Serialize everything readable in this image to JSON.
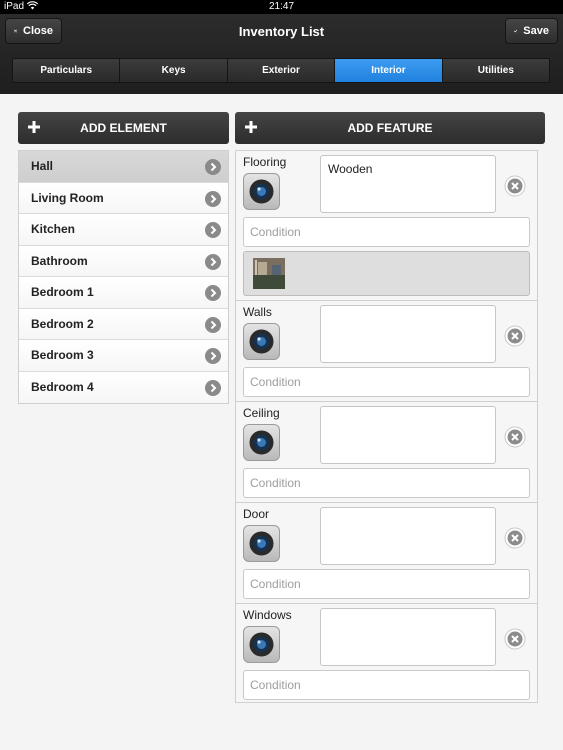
{
  "status": {
    "carrier": "iPad",
    "time": "21:47"
  },
  "header": {
    "title": "Inventory List",
    "close_label": "Close",
    "save_label": "Save"
  },
  "tabs": [
    {
      "label": "Particulars",
      "active": false
    },
    {
      "label": "Keys",
      "active": false
    },
    {
      "label": "Exterior",
      "active": false
    },
    {
      "label": "Interior",
      "active": true
    },
    {
      "label": "Utilities",
      "active": false
    }
  ],
  "add_element_label": "ADD ELEMENT",
  "add_feature_label": "ADD FEATURE",
  "rooms": [
    {
      "label": "Hall",
      "selected": true
    },
    {
      "label": "Living Room",
      "selected": false
    },
    {
      "label": "Kitchen",
      "selected": false
    },
    {
      "label": "Bathroom",
      "selected": false
    },
    {
      "label": "Bedroom 1",
      "selected": false
    },
    {
      "label": "Bedroom 2",
      "selected": false
    },
    {
      "label": "Bedroom 3",
      "selected": false
    },
    {
      "label": "Bedroom 4",
      "selected": false
    }
  ],
  "features": [
    {
      "name": "Flooring",
      "note": "Wooden",
      "condition_placeholder": "Condition",
      "condition_value": "",
      "has_photo": true
    },
    {
      "name": "Walls",
      "note": "",
      "condition_placeholder": "Condition",
      "condition_value": "",
      "has_photo": false
    },
    {
      "name": "Ceiling",
      "note": "",
      "condition_placeholder": "Condition",
      "condition_value": "",
      "has_photo": false
    },
    {
      "name": "Door",
      "note": "",
      "condition_placeholder": "Condition",
      "condition_value": "",
      "has_photo": false
    },
    {
      "name": "Windows",
      "note": "",
      "condition_placeholder": "Condition",
      "condition_value": "",
      "has_photo": false
    }
  ],
  "colors": {
    "accent": "#2b8fe8",
    "toolbar": "#262626",
    "background": "#f4f4f4"
  }
}
